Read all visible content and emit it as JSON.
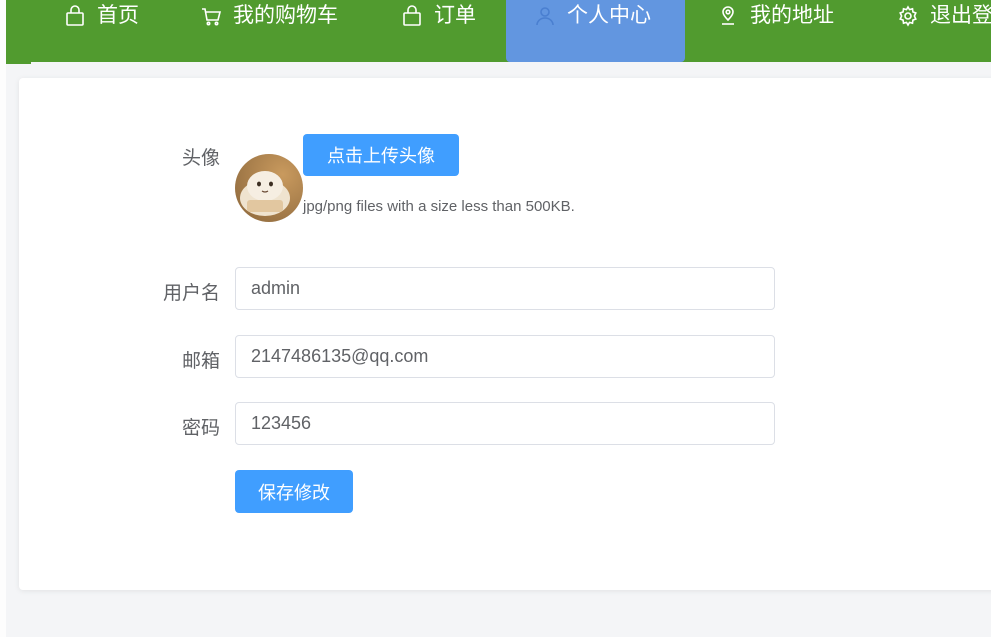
{
  "nav": {
    "items": [
      {
        "label": "首页",
        "icon": "shopping-bag-icon"
      },
      {
        "label": "我的购物车",
        "icon": "cart-icon"
      },
      {
        "label": "订单",
        "icon": "shopping-bag-icon"
      },
      {
        "label": "个人中心",
        "icon": "user-icon",
        "active": true
      },
      {
        "label": "我的地址",
        "icon": "location-icon"
      },
      {
        "label": "退出登",
        "icon": "gear-icon"
      }
    ],
    "colors": {
      "bar": "#519b2f",
      "active": "#6296e0"
    }
  },
  "form": {
    "avatar_label": "头像",
    "upload_button": "点击上传头像",
    "upload_tip": "jpg/png files with a size less than 500KB.",
    "username_label": "用户名",
    "username_value": "admin",
    "email_label": "邮箱",
    "email_value": "2147486135@qq.com",
    "password_label": "密码",
    "password_value": "123456",
    "save_button": "保存修改"
  },
  "colors": {
    "primary": "#409eff",
    "label_text": "#606266"
  }
}
